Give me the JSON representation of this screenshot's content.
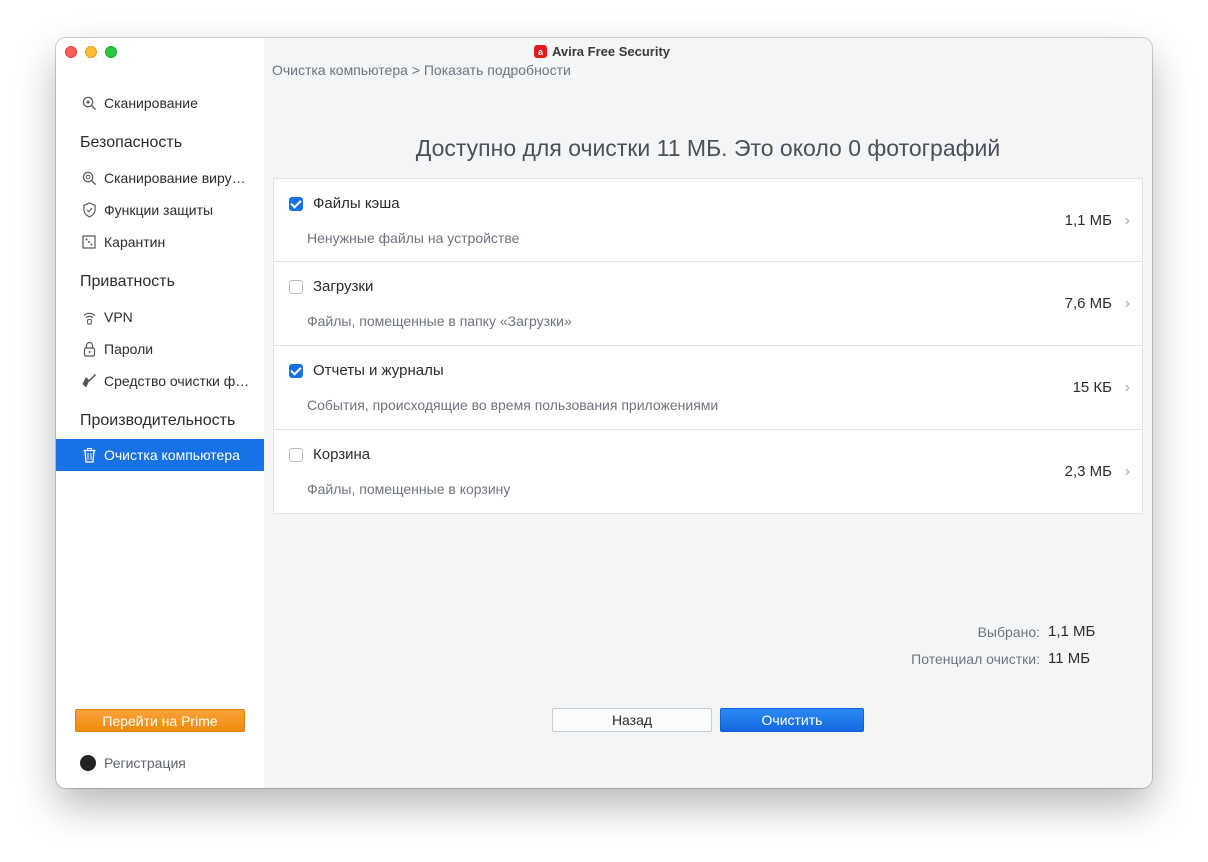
{
  "window": {
    "title": "Avira Free Security",
    "logo_glyph": "a",
    "breadcrumb": "Очистка компьютера > Показать подробности"
  },
  "sidebar": {
    "top_item": {
      "label": "Сканирование",
      "icon": "scan-icon"
    },
    "sections": [
      {
        "title": "Безопасность",
        "items": [
          {
            "label": "Сканирование виру…",
            "icon": "virus-scan-icon"
          },
          {
            "label": "Функции защиты",
            "icon": "shield-icon"
          },
          {
            "label": "Карантин",
            "icon": "quarantine-icon"
          }
        ]
      },
      {
        "title": "Приватность",
        "items": [
          {
            "label": "VPN",
            "icon": "vpn-icon"
          },
          {
            "label": "Пароли",
            "icon": "lock-icon"
          },
          {
            "label": "Средство очистки ф…",
            "icon": "broom-icon"
          }
        ]
      },
      {
        "title": "Производительность",
        "items": [
          {
            "label": "Очистка компьютера",
            "icon": "trash-icon",
            "active": true
          }
        ]
      }
    ],
    "prime_button": "Перейти на Prime",
    "registration": "Регистрация"
  },
  "main": {
    "headline": "Доступно для очистки 11 МБ. Это около 0 фотографий",
    "items": [
      {
        "title": "Файлы кэша",
        "subtitle": "Ненужные файлы на устройстве",
        "size": "1,1 МБ",
        "checked": true
      },
      {
        "title": "Загрузки",
        "subtitle": "Файлы, помещенные в папку «Загрузки»",
        "size": "7,6 МБ",
        "checked": false
      },
      {
        "title": "Отчеты и журналы",
        "subtitle": "События, происходящие во время пользования приложениями",
        "size": "15 КБ",
        "checked": true
      },
      {
        "title": "Корзина",
        "subtitle": "Файлы, помещенные в корзину",
        "size": "2,3 МБ",
        "checked": false
      }
    ],
    "selected_label": "Выбрано:",
    "selected_value": "1,1 МБ",
    "potential_label": "Потенциал очистки:",
    "potential_value": "11 МБ",
    "back_button": "Назад",
    "clean_button": "Очистить"
  },
  "colors": {
    "accent": "#1672e6",
    "prime": "#f28b0c"
  }
}
